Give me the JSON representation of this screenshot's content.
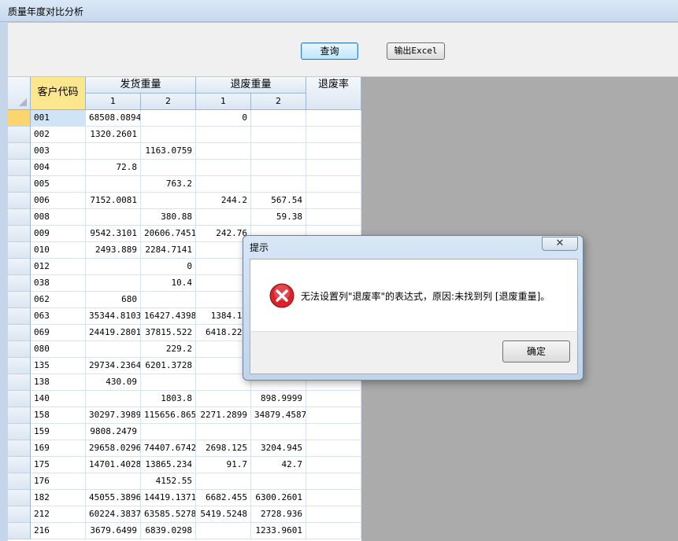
{
  "window": {
    "title": "质量年度对比分析"
  },
  "toolbar": {
    "query_label": "查询",
    "excel_label": "输出Excel"
  },
  "grid": {
    "headers": {
      "code": "客户代码",
      "ship_weight": "发货重量",
      "return_weight": "退废重量",
      "return_rate": "退废率",
      "sub1": "1",
      "sub2": "2",
      "sub3": "1",
      "sub4": "2"
    },
    "rows": [
      {
        "code": "001",
        "s1": "68508.0894",
        "s2": "",
        "r1": "0",
        "r2": "",
        "rate": ""
      },
      {
        "code": "002",
        "s1": "1320.2601",
        "s2": "",
        "r1": "",
        "r2": "",
        "rate": ""
      },
      {
        "code": "003",
        "s1": "",
        "s2": "1163.0759",
        "r1": "",
        "r2": "",
        "rate": ""
      },
      {
        "code": "004",
        "s1": "72.8",
        "s2": "",
        "r1": "",
        "r2": "",
        "rate": ""
      },
      {
        "code": "005",
        "s1": "",
        "s2": "763.2",
        "r1": "",
        "r2": "",
        "rate": ""
      },
      {
        "code": "006",
        "s1": "7152.0081",
        "s2": "",
        "r1": "244.2",
        "r2": "567.54",
        "rate": ""
      },
      {
        "code": "008",
        "s1": "",
        "s2": "380.88",
        "r1": "",
        "r2": "59.38",
        "rate": ""
      },
      {
        "code": "009",
        "s1": "9542.3101",
        "s2": "20606.7451",
        "r1": "242.76",
        "r2": "",
        "rate": ""
      },
      {
        "code": "010",
        "s1": "2493.889",
        "s2": "2284.7141",
        "r1": "",
        "r2": "",
        "rate": ""
      },
      {
        "code": "012",
        "s1": "",
        "s2": "0",
        "r1": "",
        "r2": "",
        "rate": ""
      },
      {
        "code": "038",
        "s1": "",
        "s2": "10.4",
        "r1": "",
        "r2": "",
        "rate": ""
      },
      {
        "code": "062",
        "s1": "680",
        "s2": "",
        "r1": "",
        "r2": "",
        "rate": ""
      },
      {
        "code": "063",
        "s1": "35344.8103",
        "s2": "16427.4398",
        "r1": "1384.18",
        "r2": "",
        "rate": ""
      },
      {
        "code": "069",
        "s1": "24419.2801",
        "s2": "37815.522",
        "r1": "6418.220",
        "r2": "",
        "rate": ""
      },
      {
        "code": "080",
        "s1": "",
        "s2": "229.2",
        "r1": "",
        "r2": "",
        "rate": ""
      },
      {
        "code": "135",
        "s1": "29734.2364",
        "s2": "6201.3728",
        "r1": "",
        "r2": "",
        "rate": ""
      },
      {
        "code": "138",
        "s1": "430.09",
        "s2": "",
        "r1": "",
        "r2": "",
        "rate": ""
      },
      {
        "code": "140",
        "s1": "",
        "s2": "1803.8",
        "r1": "",
        "r2": "898.9999",
        "rate": ""
      },
      {
        "code": "158",
        "s1": "30297.3989",
        "s2": "115656.865",
        "r1": "2271.2899",
        "r2": "34879.4587",
        "rate": ""
      },
      {
        "code": "159",
        "s1": "9808.2479",
        "s2": "",
        "r1": "",
        "r2": "",
        "rate": ""
      },
      {
        "code": "169",
        "s1": "29658.0296",
        "s2": "74407.6742",
        "r1": "2698.125",
        "r2": "3204.945",
        "rate": ""
      },
      {
        "code": "175",
        "s1": "14701.4028",
        "s2": "13865.234",
        "r1": "91.7",
        "r2": "42.7",
        "rate": ""
      },
      {
        "code": "176",
        "s1": "",
        "s2": "4152.55",
        "r1": "",
        "r2": "",
        "rate": ""
      },
      {
        "code": "182",
        "s1": "45055.3896",
        "s2": "14419.1371",
        "r1": "6682.455",
        "r2": "6300.2601",
        "rate": ""
      },
      {
        "code": "212",
        "s1": "60224.3837",
        "s2": "63585.5278",
        "r1": "5419.5248",
        "r2": "2728.936",
        "rate": ""
      },
      {
        "code": "216",
        "s1": "3679.6499",
        "s2": "6839.0298",
        "r1": "",
        "r2": "1233.9601",
        "rate": ""
      }
    ]
  },
  "dialog": {
    "title": "提示",
    "close_glyph": "✕",
    "message": "无法设置列\"退废率\"的表达式，原因:未找到列 [退废重量]。",
    "ok_label": "确定"
  },
  "colors": {
    "error_red": "#d8232a",
    "active_row": "#fcd56e",
    "header_code": "#fce68e"
  }
}
